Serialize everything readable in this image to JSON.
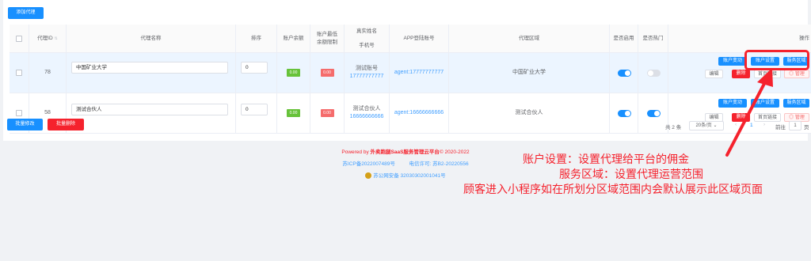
{
  "toolbar": {
    "add_label": "添加代理"
  },
  "table": {
    "headers": {
      "id": "代理ID",
      "name": "代理名称",
      "sort": "排序",
      "balance": "账户余额",
      "min_limit": "账户最低余额限制",
      "realname": "真实姓名",
      "phone": "手机号",
      "app_account": "APP登陆账号",
      "region": "代理区域",
      "enabled": "是否启用",
      "hot": "是否热门",
      "actions": "操作"
    },
    "rows": [
      {
        "id": "78",
        "name": "中国矿业大学",
        "sort": "0",
        "balance": "0.00",
        "min_limit": "0.00",
        "realname": "测试账号",
        "phone": "17777777777",
        "app_account": "agent:17777777777",
        "region": "中国矿业大学",
        "enabled": true,
        "hot": false
      },
      {
        "id": "58",
        "name": "测试合伙人",
        "sort": "0",
        "balance": "0.00",
        "min_limit": "0.00",
        "realname": "测试合伙人",
        "phone": "16666666666",
        "app_account": "agent:16666666666",
        "region": "测试合伙人",
        "enabled": true,
        "hot": true
      }
    ],
    "actions": {
      "account_change": "账户变动",
      "account_settings": "账户设置",
      "service_area": "服务区域",
      "edit": "编辑",
      "delete": "删除",
      "home_link": "首页链接",
      "manage": "◎ 管理"
    }
  },
  "bulk": {
    "edit_label": "批量修改",
    "delete_label": "批量删除"
  },
  "pager": {
    "total": "共 2 条",
    "page_size": "20条/页",
    "prev": "‹",
    "current": "1",
    "next": "›",
    "goto": "前往",
    "goto_value": "1",
    "page_unit": "页"
  },
  "footer": {
    "powered_prefix": "Powered by ",
    "powered_brand": "外卖跑腿SaaS服务管理云平台",
    "powered_suffix": "© 2020-2022",
    "icp": "苏ICP备2022007489号",
    "license": "电信许可: 苏B2-20220556",
    "police": "苏公网安备 32030302001041号"
  },
  "annotation": {
    "line1": "账户设置：设置代理给平台的佣金",
    "line2": "服务区域：设置代理运营范围",
    "line3": "顾客进入小程序如在所划分区域范围内会默认展示此区域页面"
  },
  "colors": {
    "primary": "#1890ff",
    "danger": "#f5222d",
    "annotation": "#f5222d"
  }
}
